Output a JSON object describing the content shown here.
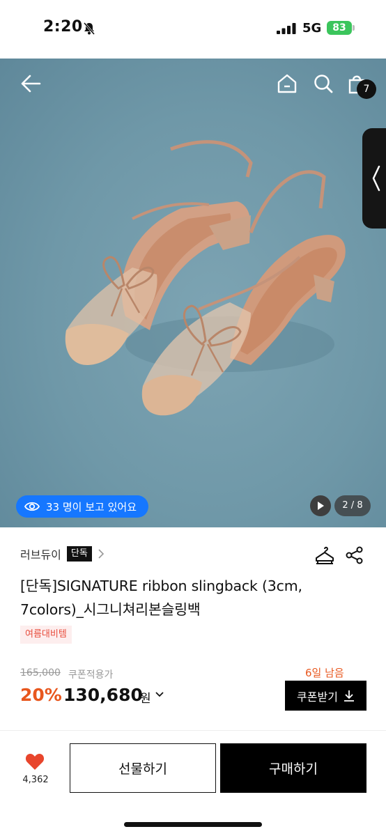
{
  "status_bar": {
    "time": "2:20",
    "network": "5G",
    "battery": "83"
  },
  "top_nav": {
    "cart_count": "7"
  },
  "gallery": {
    "viewers_text": "33 명이 보고 있어요",
    "page_indicator": "2 / 8"
  },
  "product": {
    "brand": "러브듀이",
    "brand_tag": "단독",
    "title_line1": "[단독]SIGNATURE ribbon slingback (3cm,",
    "title_line2": "7colors)_시그니쳐리본슬링백",
    "promo_tag": "여름대비템"
  },
  "pricing": {
    "original_price": "165,000",
    "coupon_note": "쿠폰적용가",
    "days_left": "6일 남음",
    "discount": "20%",
    "price": "130,680",
    "unit": "원",
    "coupon_button": "쿠폰받기"
  },
  "bottom_bar": {
    "like_count": "4,362",
    "gift_label": "선물하기",
    "buy_label": "구매하기"
  },
  "colors": {
    "accent_orange": "#e8571e",
    "viewer_blue": "#1677ff",
    "like_red": "#e8452c",
    "battery_green": "#3bc55c"
  },
  "icons": [
    "bell-mute-icon",
    "signal-icon",
    "back-arrow-icon",
    "home-icon",
    "search-icon",
    "cart-icon",
    "chevron-left-icon",
    "eye-icon",
    "play-icon",
    "chevron-right-icon",
    "wishlist-hanger-icon",
    "share-icon",
    "chevron-down-icon",
    "download-icon",
    "heart-icon"
  ]
}
